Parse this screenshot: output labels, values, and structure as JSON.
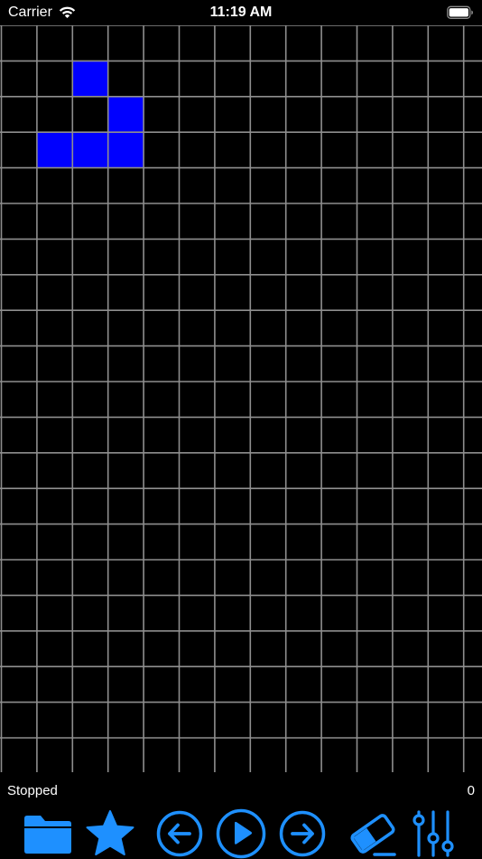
{
  "status_bar": {
    "carrier": "Carrier",
    "time": "11:19 AM"
  },
  "board": {
    "columns": 14,
    "rows": 21,
    "grid_color": "#8e8e8e",
    "live_cell_color": "#0000ff",
    "live_cells": [
      [
        2,
        1
      ],
      [
        3,
        2
      ],
      [
        1,
        3
      ],
      [
        2,
        3
      ],
      [
        3,
        3
      ]
    ]
  },
  "info": {
    "status": "Stopped",
    "generation": "0"
  },
  "toolbar": {
    "accent": "#1e90ff",
    "items": [
      {
        "icon": "folder-icon"
      },
      {
        "icon": "star-icon"
      },
      {
        "icon": "step-back-icon"
      },
      {
        "icon": "play-icon"
      },
      {
        "icon": "step-forward-icon"
      },
      {
        "icon": "eraser-icon"
      },
      {
        "icon": "sliders-icon"
      }
    ]
  }
}
